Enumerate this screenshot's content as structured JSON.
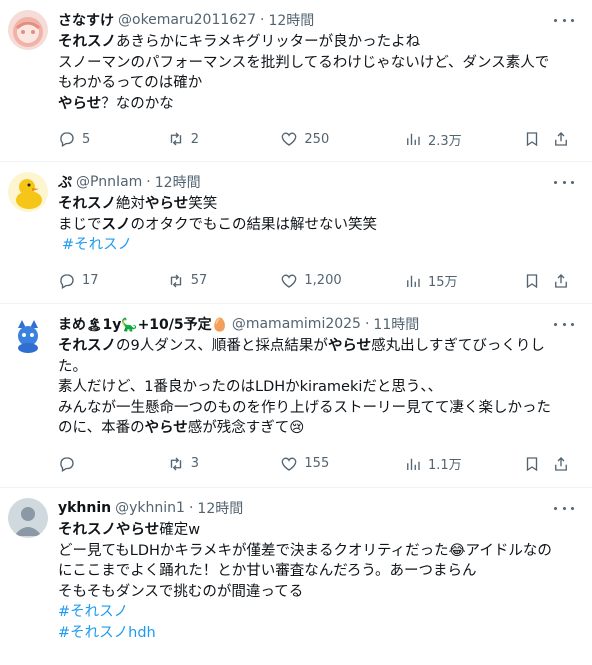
{
  "tweets": [
    {
      "name": "さなすけ",
      "handle": "@okemaru2011627",
      "dot": "·",
      "time": "12時間",
      "lines": [
        [
          {
            "t": "それスノ",
            "b": true
          },
          {
            "t": "あきらかにキラメキグリッターが良かったよね",
            "b": false
          }
        ],
        [
          {
            "t": "スノーマンのパフォーマンスを批判してるわけじゃないけど、ダンス素人で",
            "b": false
          }
        ],
        [
          {
            "t": "もわかるってのは確か",
            "b": false
          }
        ],
        [
          {
            "t": "やらせ",
            "b": true
          },
          {
            "t": "？なのかな",
            "b": false
          }
        ]
      ],
      "hashtags": [],
      "replies": "5",
      "retweets": "2",
      "likes": "250",
      "views": "2.3万"
    },
    {
      "name": "ぷ",
      "handle": "@PnnIam",
      "dot": "·",
      "time": "12時間",
      "lines": [
        [
          {
            "t": "それスノ",
            "b": true
          },
          {
            "t": "絶対",
            "b": false
          },
          {
            "t": "やらせ",
            "b": true
          },
          {
            "t": "笑笑",
            "b": false
          }
        ],
        [
          {
            "t": "まじで",
            "b": false
          },
          {
            "t": "スノ",
            "b": true
          },
          {
            "t": "のオタクでもこの結果は解せない笑笑",
            "b": false
          }
        ]
      ],
      "hashtags": [
        "#それスノ"
      ],
      "replies": "17",
      "retweets": "57",
      "likes": "1,200",
      "views": "15万"
    },
    {
      "name": "まめ",
      "name_emoji1": "🏝",
      "name_mid": "1y",
      "name_emoji2": "🦕",
      "name_tail": "+10/5予定",
      "name_emoji3": "🥚",
      "handle": "@mamamimi2025",
      "dot": "·",
      "time": "11時間",
      "lines": [
        [
          {
            "t": "それスノ",
            "b": true
          },
          {
            "t": "の9人ダンス、順番と採点結果が",
            "b": false
          },
          {
            "t": "やらせ",
            "b": true
          },
          {
            "t": "感丸出しすぎてびっくりし",
            "b": false
          }
        ],
        [
          {
            "t": "た。",
            "b": false
          }
        ],
        [
          {
            "t": "素人だけど、1番良かったのはLDHかkiramekiだと思う、、",
            "b": false
          }
        ],
        [
          {
            "t": "みんなが一生懸命一つのものを作り上げるストーリー見てて凄く楽しかった",
            "b": false
          }
        ],
        [
          {
            "t": "のに、本番の",
            "b": false
          },
          {
            "t": "やらせ",
            "b": true
          },
          {
            "t": "感が残念すぎて😢",
            "b": false
          }
        ]
      ],
      "hashtags": [],
      "replies": "",
      "retweets": "3",
      "likes": "155",
      "views": "1.1万"
    },
    {
      "name": "ykhnin",
      "handle": "@ykhnin1",
      "dot": "·",
      "time": "12時間",
      "lines": [
        [
          {
            "t": "それスノ",
            "b": true
          },
          {
            "t": "やらせ",
            "b": true
          },
          {
            "t": "確定w",
            "b": false
          }
        ],
        [
          {
            "t": "どー見てもLDHかキラメキが僅差で決まるクオリティだった😂アイドルなの",
            "b": false
          }
        ],
        [
          {
            "t": "にここまでよく踊れた！とか甘い審査なんだろう。あーつまらん",
            "b": false
          }
        ],
        [
          {
            "t": "そもそもダンスで挑むのが間違ってる",
            "b": false
          }
        ]
      ],
      "hashtags": [
        "#それスノ",
        "#それスノhdh"
      ],
      "replies": "",
      "retweets": "",
      "likes": "",
      "views": ""
    }
  ],
  "icons": {
    "reply": "reply-icon",
    "retweet": "retweet-icon",
    "like": "heart-icon",
    "views": "views-icon",
    "bookmark": "bookmark-icon",
    "share": "share-icon",
    "more": "more-icon"
  },
  "colors": {
    "text": "#0f1419",
    "secondary": "#536471",
    "link": "#1d9bf0",
    "divider": "#eff3f4"
  }
}
